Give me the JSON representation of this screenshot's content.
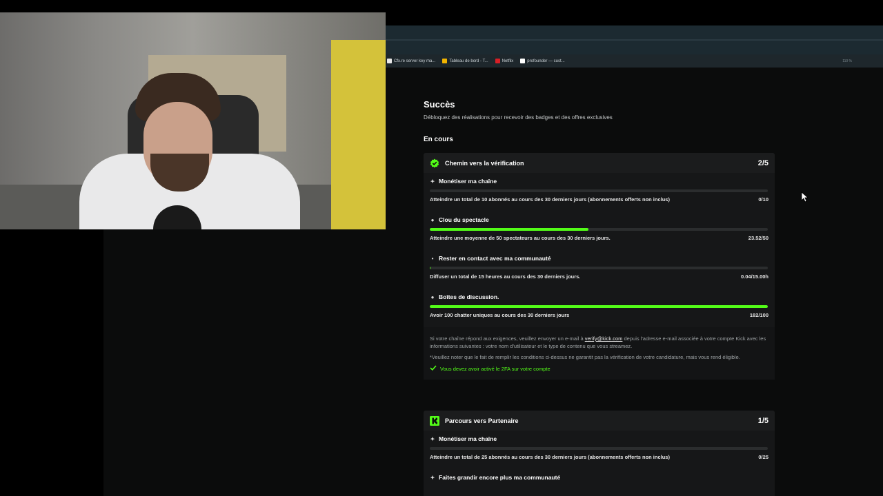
{
  "browser": {
    "bookmarks": [
      {
        "label": "Cfx.re server key ma...",
        "color": "#e8e8e8"
      },
      {
        "label": "Tableau de bord - T...",
        "color": "#f2b400"
      },
      {
        "label": "Netflix",
        "color": "#d81f26"
      },
      {
        "label": "profounder — cust...",
        "color": "#ffffff"
      }
    ],
    "zoom": "110 %"
  },
  "page": {
    "title": "Succès",
    "subtitle": "Débloquez des réalisations pour recevoir des badges et des offres exclusives",
    "section": "En cours"
  },
  "card1": {
    "title": "Chemin vers la vérification",
    "progress": "2/5",
    "tasks": [
      {
        "name": "Monétiser ma chaîne",
        "icon": "✦",
        "desc": "Atteindre un total de 10 abonnés au cours des 30 derniers jours (abonnements offerts non inclus)",
        "value": "0/10",
        "fill_pct": 0
      },
      {
        "name": "Clou du spectacle",
        "icon": "👥",
        "desc": "Atteindre une moyenne de 50 spectateurs au cours des 30 derniers jours.",
        "value": "23.52/50",
        "fill_pct": 47
      },
      {
        "name": "Rester en contact avec ma communauté",
        "icon": "📡",
        "desc": "Diffuser un total de 15 heures au cours des 30 derniers jours.",
        "value": "0.04/15.00h",
        "fill_pct": 0.3
      },
      {
        "name": "Boîtes de discussion.",
        "icon": "💬",
        "desc": "Avoir 100 chatter uniques au cours des 30 derniers jours",
        "value": "182/100",
        "fill_pct": 100
      }
    ],
    "note": {
      "line1_a": "Si votre chaîne répond aux exigences, veuillez envoyer un e-mail à ",
      "email": "verify@kick.com",
      "line1_b": " depuis l'adresse e-mail associée à votre compte Kick avec les informations suivantes : votre nom d'utilisateur et le type de contenu que vous streamez.",
      "line2": "*Veuillez noter que le fait de remplir les conditions ci-dessus ne garantit pas la vérification de votre candidature, mais vous rend éligible.",
      "check": "Vous devez avoir activé le 2FA sur votre compte"
    }
  },
  "card2": {
    "title": "Parcours vers Partenaire",
    "progress": "1/5",
    "tasks": [
      {
        "name": "Monétiser ma chaîne",
        "icon": "✦",
        "desc": "Atteindre un total de 25 abonnés au cours des 30 derniers jours (abonnements offerts non inclus)",
        "value": "0/25",
        "fill_pct": 0
      },
      {
        "name": "Faites grandir encore plus ma communauté",
        "icon": "✦",
        "desc": "",
        "value": "",
        "fill_pct": 0
      }
    ]
  },
  "colors": {
    "accent": "#53fc18",
    "card": "#161718",
    "page": "#0b0c0c"
  }
}
